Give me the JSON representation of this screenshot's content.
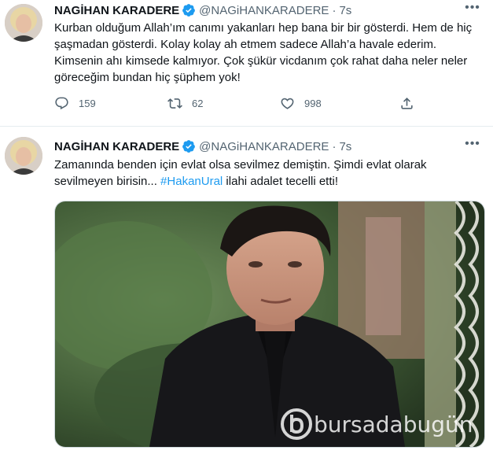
{
  "tweets": [
    {
      "author_name": "NAGİHAN KARADERE",
      "handle": "@NAGiHANKARADERE",
      "separator": "·",
      "time": "7s",
      "text": "Kurban olduğum Allah’ım canımı yakanları hep bana bir bir gösterdi. Hem de hiç şaşmadan gösterdi. Kolay kolay ah etmem sadece Allah’a havale ederim. Kimsenin ahı kimsede kalmıyor. Çok şükür vicdanım çok rahat daha neler neler göreceğim bundan hiç şüphem yok!",
      "replies": "159",
      "retweets": "62",
      "likes": "998"
    },
    {
      "author_name": "NAGİHAN KARADERE",
      "handle": "@NAGiHANKARADERE",
      "separator": "·",
      "time": "7s",
      "text_line1": "Zamanında benden için evlat olsa sevilmez demiştin. Şimdi evlat olarak sevilmeyen birisin... ",
      "hashtag": "#HakanUral",
      "text_tail": " ilahi adalet tecelli etti!"
    }
  ],
  "watermark": "bursadabugün",
  "icons": [
    "verified-badge-icon",
    "more-options-icon",
    "reply-icon",
    "retweet-icon",
    "like-icon",
    "share-icon"
  ],
  "colors": {
    "accent": "#1d9bf0",
    "secondary_text": "#536471",
    "border": "#e6ecf0"
  }
}
